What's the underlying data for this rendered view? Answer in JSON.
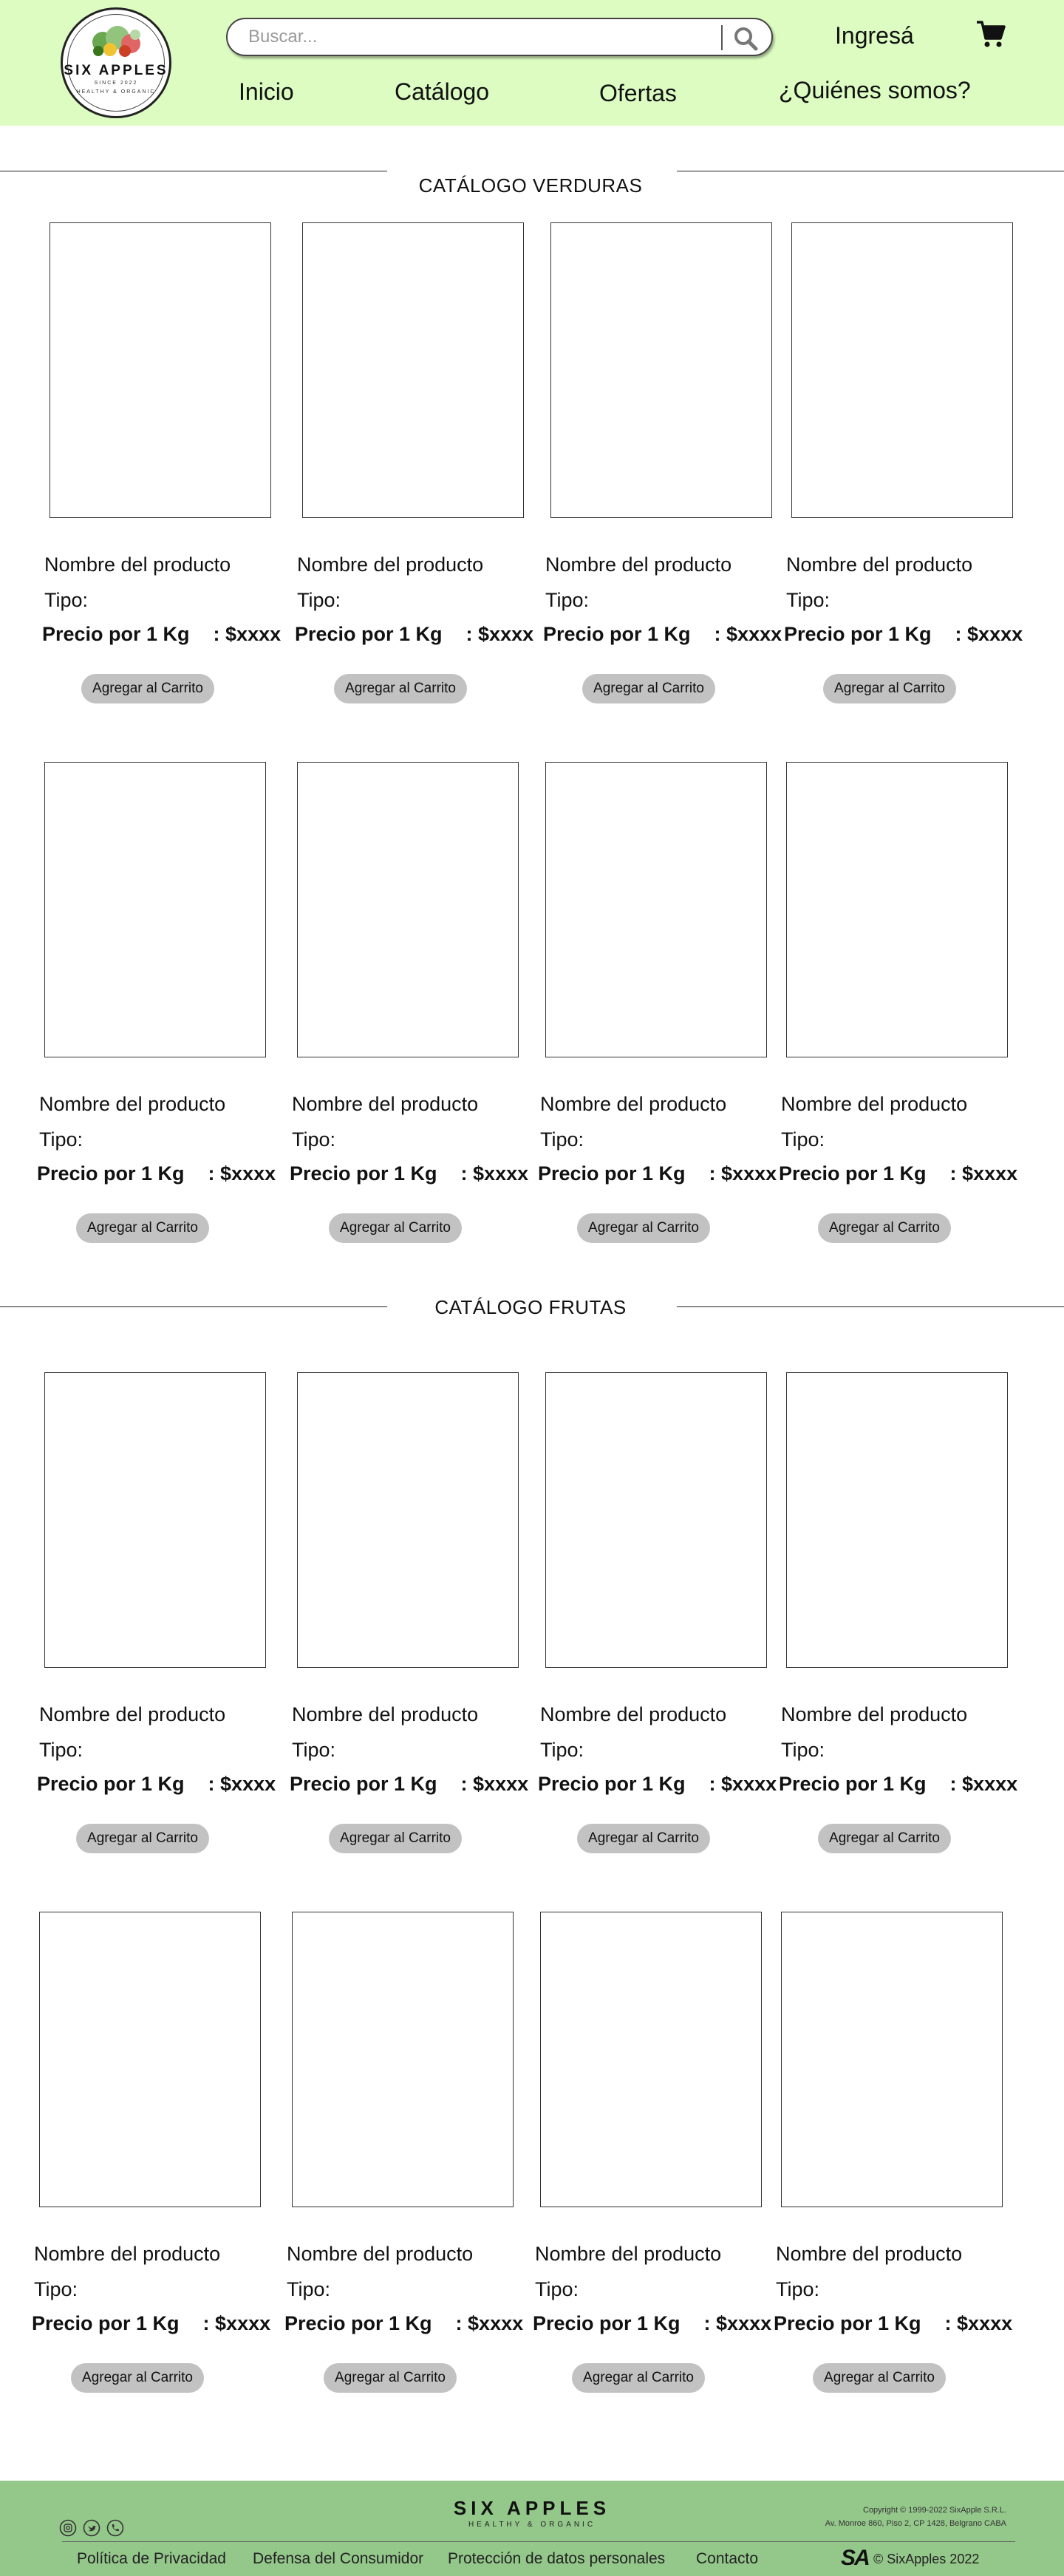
{
  "header": {
    "logo": {
      "brand": "SIX APPLES",
      "since": "SINCE 2022",
      "motto": "HEALTHY & ORGANIC"
    },
    "search": {
      "placeholder": "Buscar..."
    },
    "login_label": "Ingresá",
    "nav": [
      "Inicio",
      "Catálogo",
      "Ofertas",
      "¿Quiénes somos?"
    ]
  },
  "sections": [
    {
      "title": "CATÁLOGO VERDURAS"
    },
    {
      "title": "CATÁLOGO FRUTAS"
    }
  ],
  "product_template": {
    "name": "Nombre del producto",
    "type": "Tipo:",
    "price_label": "Precio por 1 Kg",
    "price_value": ": $xxxx",
    "button_label": "Agregar al Carrito"
  },
  "footer": {
    "brand": "SIX APPLES",
    "motto": "HEALTHY & ORGANIC",
    "copyright": "Copyright © 1999-2022 SixApple S.R.L.",
    "address": "Av. Monroe 860, Piso 2, CP 1428, Belgrano CABA",
    "links": [
      "Política de Privacidad",
      "Defensa del Consumidor",
      "Protección de datos personales",
      "Contacto"
    ],
    "logo_mark": "SA",
    "rights": "© SixApples 2022",
    "social": [
      "instagram-icon",
      "twitter-icon",
      "phone-icon"
    ]
  }
}
